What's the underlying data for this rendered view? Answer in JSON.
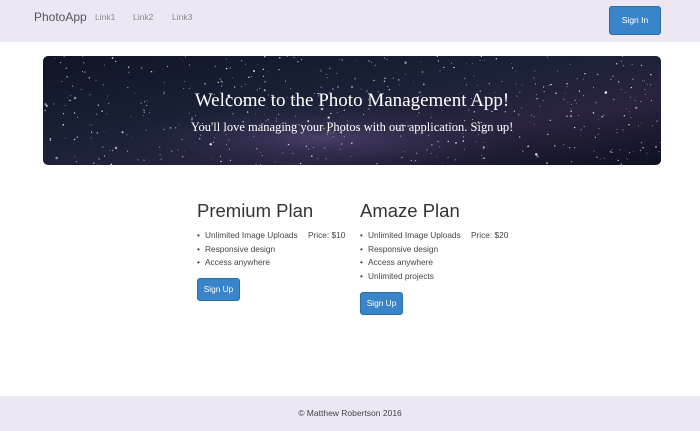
{
  "navbar": {
    "brand": "PhotoApp",
    "links": [
      "Link1",
      "Link2",
      "Link3"
    ],
    "signin_label": "Sign In"
  },
  "hero": {
    "title": "Welcome to the Photo Management App!",
    "subtitle": "You'll love managing your Photos with our application. Sign up!"
  },
  "plans": [
    {
      "title": "Premium Plan",
      "features": [
        "Unlimited Image Uploads",
        "Responsive design",
        "Access anywhere"
      ],
      "price": "Price: $10",
      "button_label": "Sign Up"
    },
    {
      "title": "Amaze Plan",
      "features": [
        "Unlimited Image Uploads",
        "Responsive design",
        "Access anywhere",
        "Unlimited projects"
      ],
      "price": "Price: $20",
      "button_label": "Sign Up"
    }
  ],
  "footer": {
    "text": "© Matthew Robertson 2016"
  },
  "colors": {
    "accent": "#3a84c9",
    "nav_bg": "#ede7f3"
  }
}
